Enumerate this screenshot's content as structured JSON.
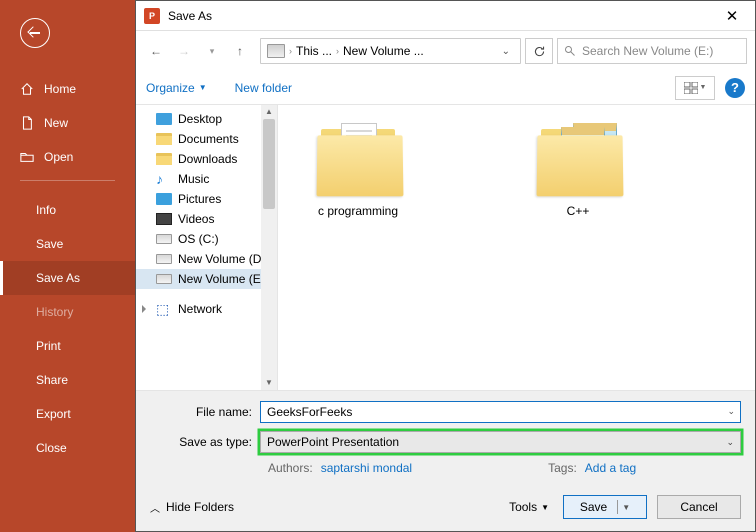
{
  "sidebar": {
    "home": "Home",
    "new": "New",
    "open": "Open",
    "info": "Info",
    "save": "Save",
    "save_as": "Save As",
    "history": "History",
    "print": "Print",
    "share": "Share",
    "export": "Export",
    "close": "Close"
  },
  "dialog": {
    "title": "Save As",
    "breadcrumb": {
      "part1": "This ...",
      "part2": "New Volume ..."
    },
    "search_placeholder": "Search New Volume (E:)",
    "organize": "Organize",
    "new_folder": "New folder",
    "help": "?",
    "tree": {
      "desktop": "Desktop",
      "documents": "Documents",
      "downloads": "Downloads",
      "music": "Music",
      "pictures": "Pictures",
      "videos": "Videos",
      "os_c": "OS (C:)",
      "vol_d": "New Volume (D:)",
      "vol_e": "New Volume (E:)",
      "network": "Network"
    },
    "folders": {
      "f1": "c programming",
      "f2": "C++"
    },
    "filename_label": "File name:",
    "filename_value": "GeeksForFeeks",
    "type_label": "Save as type:",
    "type_value": "PowerPoint Presentation",
    "authors_label": "Authors:",
    "authors_value": "saptarshi mondal",
    "tags_label": "Tags:",
    "tags_value": "Add a tag",
    "hide_folders": "Hide Folders",
    "tools": "Tools",
    "save_btn": "Save",
    "cancel_btn": "Cancel"
  }
}
